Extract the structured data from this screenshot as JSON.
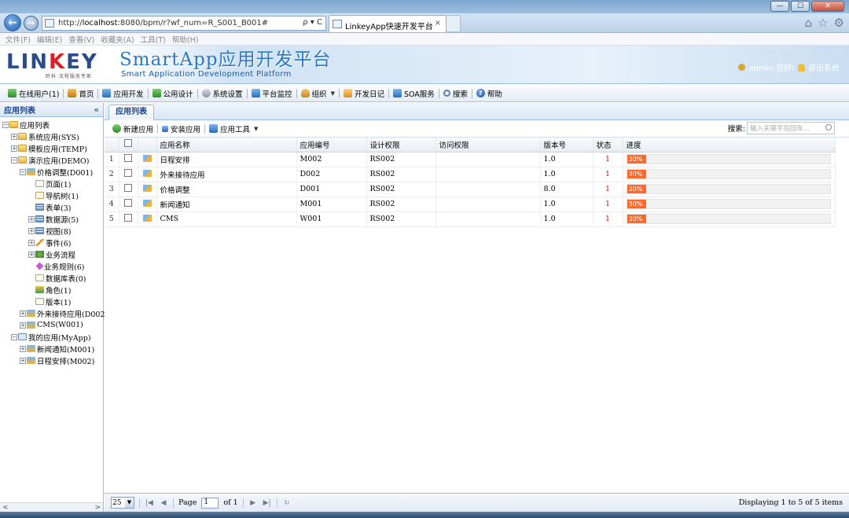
{
  "browser": {
    "url_prefix": "http://",
    "url_host": "localhost",
    "url_rest": ":8080/bpm/r?wf_num=R_S001_B001#",
    "url_tools": "ρ ▾ C",
    "tab_title": "LinkeyApp快速开发平台",
    "tab_close": "×",
    "menus": [
      "文件(F)",
      "编辑(E)",
      "查看(V)",
      "收藏夹(A)",
      "工具(T)",
      "帮助(H)"
    ],
    "window_buttons": [
      "—",
      "☐",
      "✕"
    ],
    "icons": [
      "⌂",
      "☆",
      "⚙"
    ]
  },
  "header": {
    "logo_l": "LIN",
    "logo_k": "K",
    "logo_r": "EY",
    "logo_sub": "聆科·流程服务专家",
    "brand_title": "SmartApp应用开发平台",
    "brand_subtitle": "Smart Application Development Platform",
    "user_text": "admin 您好!",
    "logout_text": "退出系统"
  },
  "toolbar": {
    "items": [
      {
        "label": "在线用户(1)",
        "icon": "users-icon"
      },
      {
        "label": "首页",
        "icon": "home-icon"
      },
      {
        "label": "应用开发",
        "icon": "app-icon"
      },
      {
        "label": "公用设计",
        "icon": "design-icon"
      },
      {
        "label": "系统设置",
        "icon": "gear-icon"
      },
      {
        "label": "平台监控",
        "icon": "monitor-icon"
      },
      {
        "label": "组织",
        "icon": "org-icon"
      },
      {
        "label": "开发日记",
        "icon": "diary-icon"
      },
      {
        "label": "SOA服务",
        "icon": "soa-icon"
      },
      {
        "label": "搜索",
        "icon": "search-icon"
      },
      {
        "label": "帮助",
        "icon": "help-icon"
      }
    ]
  },
  "left_panel": {
    "title": "应用列表",
    "collapse": "«",
    "tree": [
      {
        "label": "应用列表",
        "level": 0,
        "exp": "⊟",
        "icon": "folder"
      },
      {
        "label": "系统应用(SYS)",
        "level": 1,
        "exp": "⊞",
        "icon": "folder"
      },
      {
        "label": "模板应用(TEMP)",
        "level": 1,
        "exp": "⊞",
        "icon": "folder"
      },
      {
        "label": "演示应用(DEMO)",
        "level": 1,
        "exp": "⊟",
        "icon": "folder"
      },
      {
        "label": "价格调整(D001)",
        "level": 2,
        "exp": "⊟",
        "icon": "app"
      },
      {
        "label": "页面(1)",
        "level": 3,
        "exp": "",
        "icon": "doc"
      },
      {
        "label": "导航树(1)",
        "level": 3,
        "exp": "",
        "icon": "doc"
      },
      {
        "label": "表单(3)",
        "level": 3,
        "exp": "",
        "icon": "grid"
      },
      {
        "label": "数据源(5)",
        "level": 3,
        "exp": "⊞",
        "icon": "grid"
      },
      {
        "label": "视图(8)",
        "level": 3,
        "exp": "⊞",
        "icon": "grid"
      },
      {
        "label": "事件(6)",
        "level": 3,
        "exp": "⊞",
        "icon": "pen"
      },
      {
        "label": "业务流程",
        "level": 3,
        "exp": "⊞",
        "icon": "gear"
      },
      {
        "label": "业务规则(6)",
        "level": 3,
        "exp": "",
        "icon": "diamond"
      },
      {
        "label": "数据库表(0)",
        "level": 3,
        "exp": "",
        "icon": "doc"
      },
      {
        "label": "角色(1)",
        "level": 3,
        "exp": "",
        "icon": "role"
      },
      {
        "label": "版本(1)",
        "level": 3,
        "exp": "",
        "icon": "doc"
      },
      {
        "label": "外来接待应用(D002)",
        "level": 2,
        "exp": "⊞",
        "icon": "app"
      },
      {
        "label": "CMS(W001)",
        "level": 2,
        "exp": "⊞",
        "icon": "app"
      },
      {
        "label": "我的应用(MyApp)",
        "level": 1,
        "exp": "⊟",
        "icon": "myapp"
      },
      {
        "label": "新闻通知(M001)",
        "level": 2,
        "exp": "⊞",
        "icon": "app"
      },
      {
        "label": "日程安排(M002)",
        "level": 2,
        "exp": "⊞",
        "icon": "app"
      }
    ],
    "scroll_left": "<",
    "scroll_right": ">"
  },
  "main": {
    "tab_label": "应用列表",
    "grid_toolbar": {
      "new_app": "新建应用",
      "install_app": "安装应用",
      "app_tools": "应用工具"
    },
    "search_label": "搜索:",
    "search_placeholder": "输入关键字后回车...",
    "columns": [
      "",
      "",
      "",
      "应用名称",
      "应用编号",
      "设计权限",
      "访问权限",
      "版本号",
      "状态",
      "进度"
    ],
    "rows": [
      {
        "n": "1",
        "name": "日程安排",
        "code": "M002",
        "design": "RS002",
        "access": "",
        "version": "1.0",
        "status": "1",
        "progress": 30,
        "progress_label": "30%"
      },
      {
        "n": "2",
        "name": "外来接待应用",
        "code": "D002",
        "design": "RS002",
        "access": "",
        "version": "1.0",
        "status": "1",
        "progress": 30,
        "progress_label": "30%"
      },
      {
        "n": "3",
        "name": "价格调整",
        "code": "D001",
        "design": "RS002",
        "access": "",
        "version": "8.0",
        "status": "1",
        "progress": 30,
        "progress_label": "30%"
      },
      {
        "n": "4",
        "name": "新闻通知",
        "code": "M001",
        "design": "RS002",
        "access": "",
        "version": "1.0",
        "status": "1",
        "progress": 30,
        "progress_label": "30%"
      },
      {
        "n": "5",
        "name": "CMS",
        "code": "W001",
        "design": "RS002",
        "access": "",
        "version": "1.0",
        "status": "1",
        "progress": 30,
        "progress_label": "30%"
      }
    ],
    "pager": {
      "page_size": "25",
      "page_label": "Page",
      "page_value": "1",
      "of_label": "of 1",
      "display_text": "Displaying 1 to 5 of 5 items"
    }
  },
  "colors": {
    "accent": "#15428b",
    "progress": "#ff6a2c",
    "status": "#dd1111"
  }
}
